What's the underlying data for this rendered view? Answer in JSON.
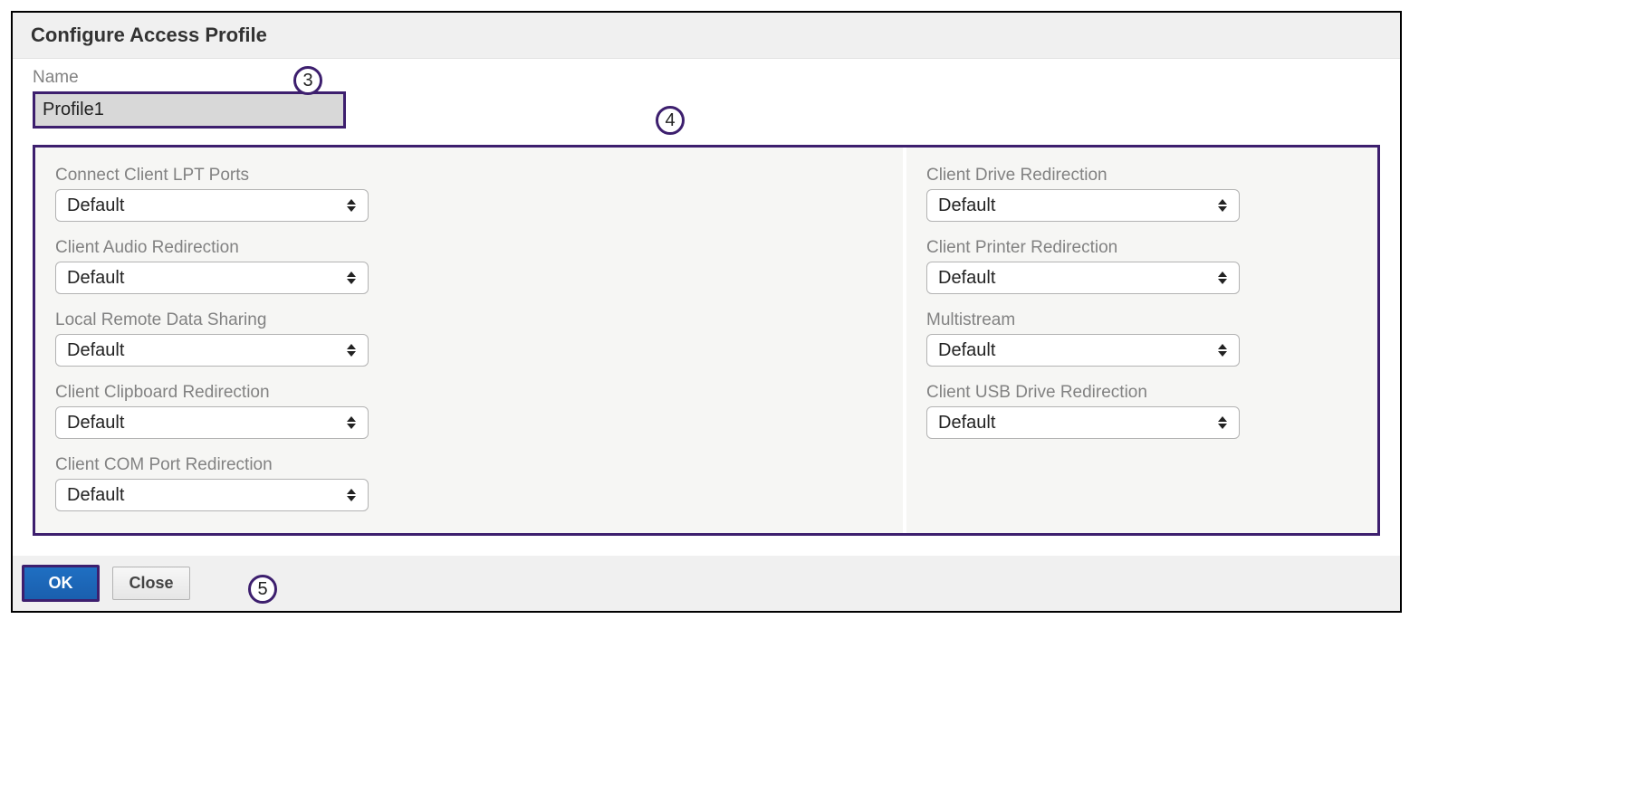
{
  "dialog": {
    "title": "Configure Access Profile",
    "name_label": "Name",
    "name_value": "Profile1"
  },
  "callouts": {
    "c3": "3",
    "c4": "4",
    "c5": "5"
  },
  "left_fields": [
    {
      "label": "Connect Client LPT Ports",
      "value": "Default"
    },
    {
      "label": "Client Audio Redirection",
      "value": "Default"
    },
    {
      "label": "Local Remote Data Sharing",
      "value": "Default"
    },
    {
      "label": "Client Clipboard Redirection",
      "value": "Default"
    },
    {
      "label": "Client COM Port Redirection",
      "value": "Default"
    }
  ],
  "right_fields": [
    {
      "label": "Client Drive Redirection",
      "value": "Default"
    },
    {
      "label": "Client Printer Redirection",
      "value": "Default"
    },
    {
      "label": "Multistream",
      "value": "Default"
    },
    {
      "label": "Client USB Drive Redirection",
      "value": "Default"
    }
  ],
  "buttons": {
    "ok": "OK",
    "close": "Close"
  }
}
